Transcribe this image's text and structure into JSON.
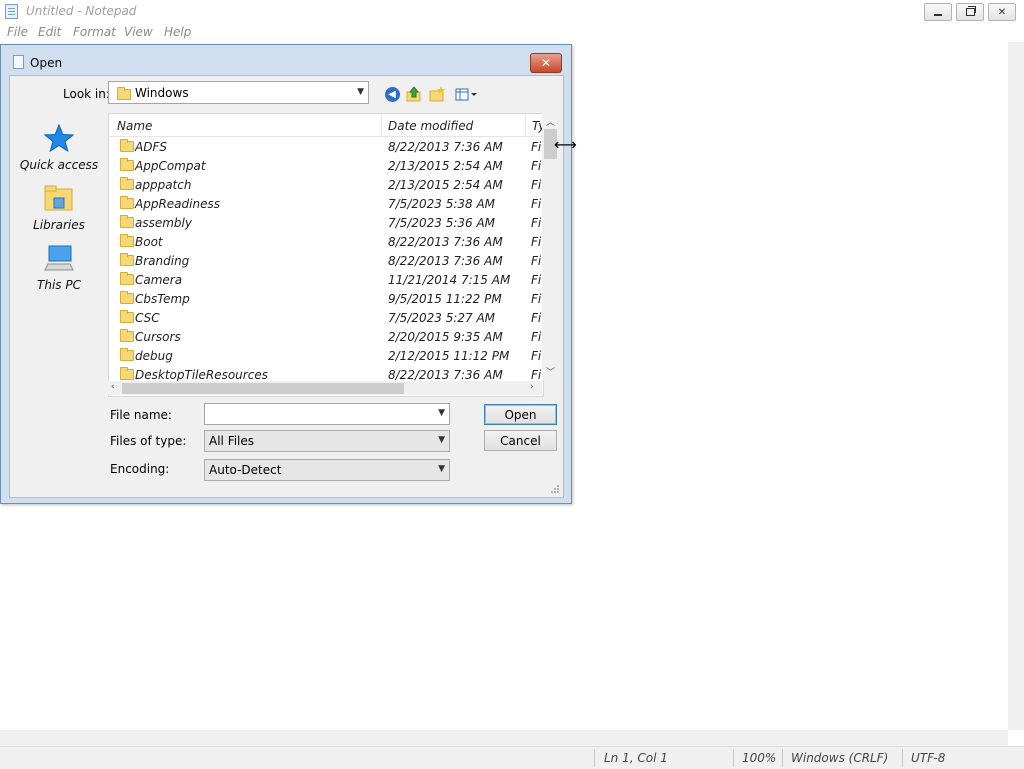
{
  "notepad": {
    "title": "Untitled - Notepad",
    "menu": [
      "File",
      "Edit",
      "Format",
      "View",
      "Help"
    ],
    "status": {
      "position": "Ln 1, Col 1",
      "zoom": "100%",
      "line_ending": "Windows (CRLF)",
      "encoding": "UTF-8"
    }
  },
  "dialog": {
    "title": "Open",
    "close_label": "✕",
    "look_in_label": "Look in:",
    "look_in_value": "Windows",
    "places": [
      "Quick access",
      "Libraries",
      "This PC"
    ],
    "columns": {
      "name": "Name",
      "date": "Date modified",
      "type": "Ty"
    },
    "files": [
      {
        "name": "ADFS",
        "date": "8/22/2013 7:36 AM",
        "type": "Fi"
      },
      {
        "name": "AppCompat",
        "date": "2/13/2015 2:54 AM",
        "type": "Fi"
      },
      {
        "name": "apppatch",
        "date": "2/13/2015 2:54 AM",
        "type": "Fi"
      },
      {
        "name": "AppReadiness",
        "date": "7/5/2023 5:38 AM",
        "type": "Fi"
      },
      {
        "name": "assembly",
        "date": "7/5/2023 5:36 AM",
        "type": "Fi"
      },
      {
        "name": "Boot",
        "date": "8/22/2013 7:36 AM",
        "type": "Fi"
      },
      {
        "name": "Branding",
        "date": "8/22/2013 7:36 AM",
        "type": "Fi"
      },
      {
        "name": "Camera",
        "date": "11/21/2014 7:15 AM",
        "type": "Fi"
      },
      {
        "name": "CbsTemp",
        "date": "9/5/2015 11:22 PM",
        "type": "Fi"
      },
      {
        "name": "CSC",
        "date": "7/5/2023 5:27 AM",
        "type": "Fi"
      },
      {
        "name": "Cursors",
        "date": "2/20/2015 9:35 AM",
        "type": "Fi"
      },
      {
        "name": "debug",
        "date": "2/12/2015 11:12 PM",
        "type": "Fi"
      },
      {
        "name": "DesktopTileResources",
        "date": "8/22/2013 7:36 AM",
        "type": "Fi"
      }
    ],
    "file_name_label": "File name:",
    "file_name_value": "",
    "files_of_type_label": "Files of type:",
    "files_of_type_value": "All Files",
    "encoding_label": "Encoding:",
    "encoding_value": "Auto-Detect",
    "open_label": "Open",
    "cancel_label": "Cancel"
  },
  "colors": {
    "dialog_frame": "#cfdfef",
    "close_button": "#c9482d",
    "folder": "#f6d875"
  }
}
